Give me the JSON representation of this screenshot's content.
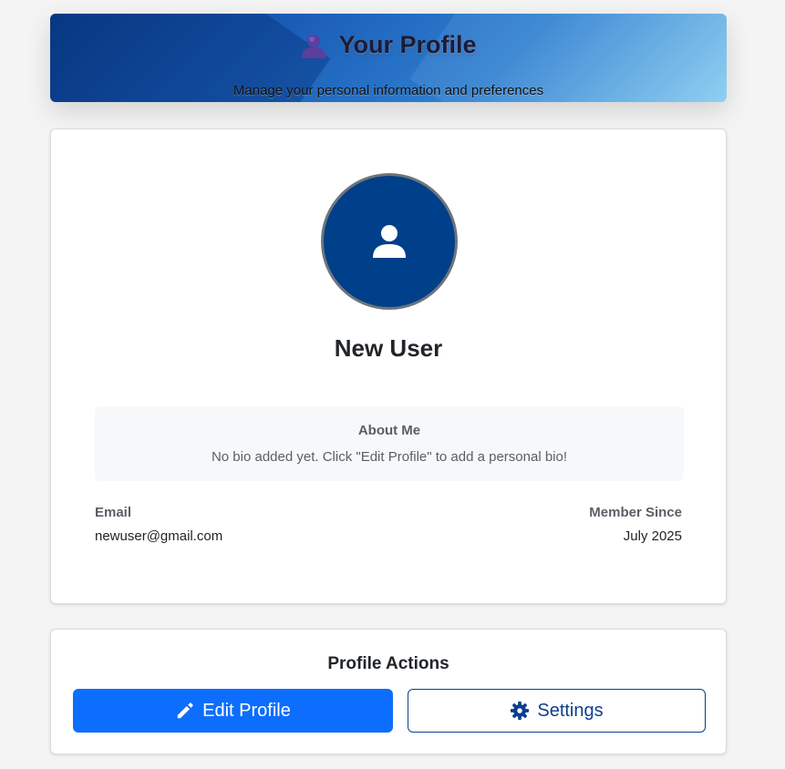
{
  "header": {
    "title_icon": "user-silhouette-icon",
    "title": "Your Profile",
    "subtitle": "Manage your personal information and preferences"
  },
  "profile": {
    "avatar_icon": "user-icon",
    "name": "New User",
    "about": {
      "title": "About Me",
      "text": "No bio added yet. Click \"Edit Profile\" to add a personal bio!"
    },
    "email_label": "Email",
    "email": "newuser@gmail.com",
    "member_since_label": "Member Since",
    "member_since": "July 2025"
  },
  "actions": {
    "title": "Profile Actions",
    "edit_label": "Edit Profile",
    "edit_icon": "pencil-icon",
    "settings_label": "Settings",
    "settings_icon": "gear-icon"
  },
  "colors": {
    "primary": "#0d6efd",
    "avatar_bg": "#003f8a",
    "outline": "#0b3f8c"
  }
}
